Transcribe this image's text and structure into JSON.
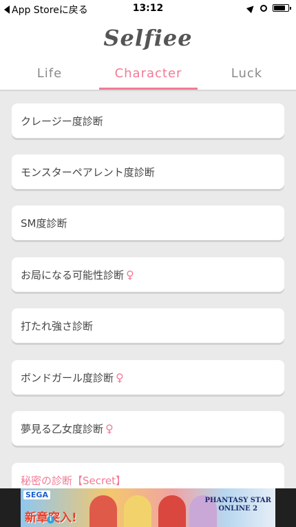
{
  "status_bar": {
    "back_label": "App Storeに戻る",
    "time": "13:12",
    "battery_level": 0.85
  },
  "header": {
    "title": "Selfiee",
    "tabs": [
      {
        "label": "Life",
        "active": false
      },
      {
        "label": "Character",
        "active": true
      },
      {
        "label": "Luck",
        "active": false
      }
    ]
  },
  "list": {
    "items": [
      {
        "label": "クレージー度診断",
        "female": false
      },
      {
        "label": "モンスターペアレント度診断",
        "female": false
      },
      {
        "label": "SM度診断",
        "female": false
      },
      {
        "label": "お局になる可能性診断",
        "female": true
      },
      {
        "label": "打たれ強さ診断",
        "female": false
      },
      {
        "label": "ボンドガール度診断",
        "female": true
      },
      {
        "label": "夢見る乙女度診断",
        "female": true
      },
      {
        "label": "秘密の診断【Secret】",
        "female": false,
        "highlight": true
      }
    ],
    "female_symbol": "♀"
  },
  "ad": {
    "brand": "SEGA",
    "headline": "新章突入!",
    "product_line1": "PHANTASY STAR",
    "product_line2": "ONLINE 2",
    "info_glyph": "i"
  },
  "colors": {
    "accent": "#f07b96",
    "background": "#eaeaea"
  },
  "icons": {
    "back": "back-arrow-icon",
    "location": "location-arrow-icon",
    "alarm": "alarm-clock-icon",
    "battery": "battery-icon",
    "female": "female-symbol-icon"
  }
}
